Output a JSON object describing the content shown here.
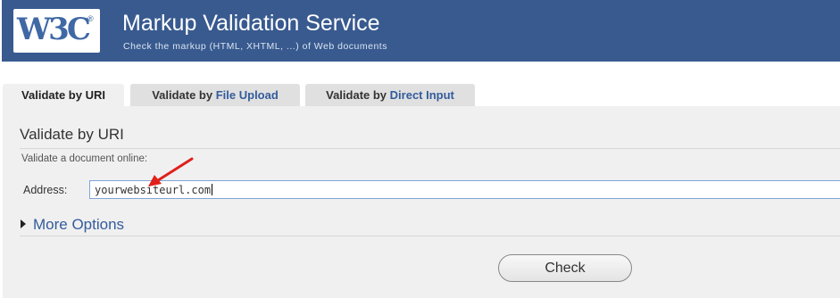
{
  "header": {
    "logo_text": "W3C",
    "logo_mark": "®",
    "title": "Markup Validation Service",
    "subtitle": "Check the markup (HTML, XHTML, ...) of Web documents"
  },
  "tabs": [
    {
      "prefix": "Validate by",
      "highlight": "URI",
      "active": true
    },
    {
      "prefix": "Validate by",
      "highlight": "File Upload",
      "active": false
    },
    {
      "prefix": "Validate by",
      "highlight": "Direct Input",
      "active": false
    }
  ],
  "panel": {
    "title": "Validate by URI",
    "description": "Validate a document online:",
    "address_label": "Address:",
    "address_value": "yourwebsiteurl.com",
    "more_options": "More Options",
    "check_button": "Check"
  },
  "colors": {
    "banner": "#385a8f",
    "link": "#345b9c",
    "annotation_arrow": "#e0201b"
  }
}
